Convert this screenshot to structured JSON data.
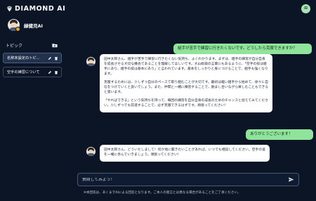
{
  "header": {
    "logo_text": "DIAMOND AI",
    "menu_icon": "grid-icon"
  },
  "colors": {
    "background": "#0b1526",
    "user_bubble": "#8fe39a",
    "ai_bubble": "#ffffff",
    "accent": "#a7e3b5"
  },
  "sidebar": {
    "profile_name": "緑健児AI",
    "topic_title": "トピック",
    "new_topic_icon": "folder-plus-icon",
    "topics": [
      {
        "label": "名称未設定のトピ…",
        "active": true
      },
      {
        "label": "空手の練習について",
        "active": false
      }
    ]
  },
  "chat": {
    "messages": [
      {
        "role": "user",
        "text": "組手が苦手で練習に行きたくないです。どうしたら克服できますか？"
      },
      {
        "role": "ai",
        "paragraphs": [
          "田中太郎さん、組手が苦手で練習に行きたくない気持ち、よくわかります。まずは、組手の練習が自分自身を成長させる大切な機会であることを理解してほしいです。大山総裁の言葉にもあるように、「空手の技は組手にあり、組手の技は基本にあり」と言われています。基本をしっかりと身につけることで、組手も強くなります。",
          "克服するためには、少しずつ自分のペースで取り組むことが大切です。最初は軽い組手から始めて、徐々に自信をつけていくと良いでしょう。また、仲間と一緒に練習することで、励まし合いながら楽しむこともできると思います。",
          "「やればできる」という気持ちを持って、毎回の練習を自分自身の成長のためのチャンスと捉えてみてください。少しずつでも前進することで、必ず克服できるはずです。頑張ってください！"
        ]
      },
      {
        "role": "user",
        "text": "ありがとうございます！"
      },
      {
        "role": "ai",
        "paragraphs": [
          "田中太郎さん、どういたしまして！何か他に聞きたいことがあれば、いつでも相談してください。空手の道を一緒に歩んでいきましょう。頑張ってください！"
        ]
      }
    ],
    "input_placeholder": "質問してみよう！",
    "send_icon": "send-icon",
    "disclaimer": "※本回答は、あくまでAIによる回答となります。ご本人の発言とは異なる場合があることをご了承ください。"
  }
}
